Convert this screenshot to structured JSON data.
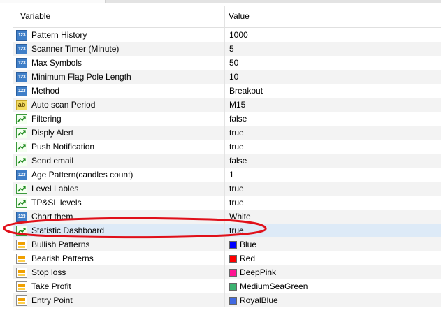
{
  "header": {
    "variable": "Variable",
    "value": "Value"
  },
  "rows": [
    {
      "icon": "number-icon",
      "name": "Pattern History",
      "value": "1000"
    },
    {
      "icon": "number-icon",
      "name": "Scanner Timer (Minute)",
      "value": "5"
    },
    {
      "icon": "number-icon",
      "name": "Max Symbols",
      "value": "50"
    },
    {
      "icon": "number-icon",
      "name": "Minimum Flag Pole Length",
      "value": "10"
    },
    {
      "icon": "number-icon",
      "name": "Method",
      "value": "Breakout"
    },
    {
      "icon": "text-icon",
      "name": "Auto scan Period",
      "value": "M15"
    },
    {
      "icon": "boolean-icon",
      "name": "Filtering",
      "value": "false"
    },
    {
      "icon": "boolean-icon",
      "name": "Disply Alert",
      "value": "true"
    },
    {
      "icon": "boolean-icon",
      "name": "Push Notification",
      "value": "true"
    },
    {
      "icon": "boolean-icon",
      "name": "Send email",
      "value": "false"
    },
    {
      "icon": "number-icon",
      "name": "Age Pattern(candles count)",
      "value": "1"
    },
    {
      "icon": "boolean-icon",
      "name": "Level Lables",
      "value": "true"
    },
    {
      "icon": "boolean-icon",
      "name": "TP&SL levels",
      "value": "true"
    },
    {
      "icon": "number-icon",
      "name": "Chart them",
      "value": "White"
    },
    {
      "icon": "boolean-icon",
      "name": "Statistic Dashboard",
      "value": "true",
      "selected": true
    },
    {
      "icon": "color-icon",
      "name": "Bullish Patterns",
      "value": "Blue",
      "swatch": "#0000ff"
    },
    {
      "icon": "color-icon",
      "name": "Bearish Patterns",
      "value": "Red",
      "swatch": "#ff0000"
    },
    {
      "icon": "color-icon",
      "name": "Stop loss",
      "value": "DeepPink",
      "swatch": "#ff1493"
    },
    {
      "icon": "color-icon",
      "name": "Take Profit",
      "value": "MediumSeaGreen",
      "swatch": "#3cb371"
    },
    {
      "icon": "color-icon",
      "name": "Entry Point",
      "value": "RoyalBlue",
      "swatch": "#4169e1"
    }
  ],
  "annotation_color": "#e0101a"
}
